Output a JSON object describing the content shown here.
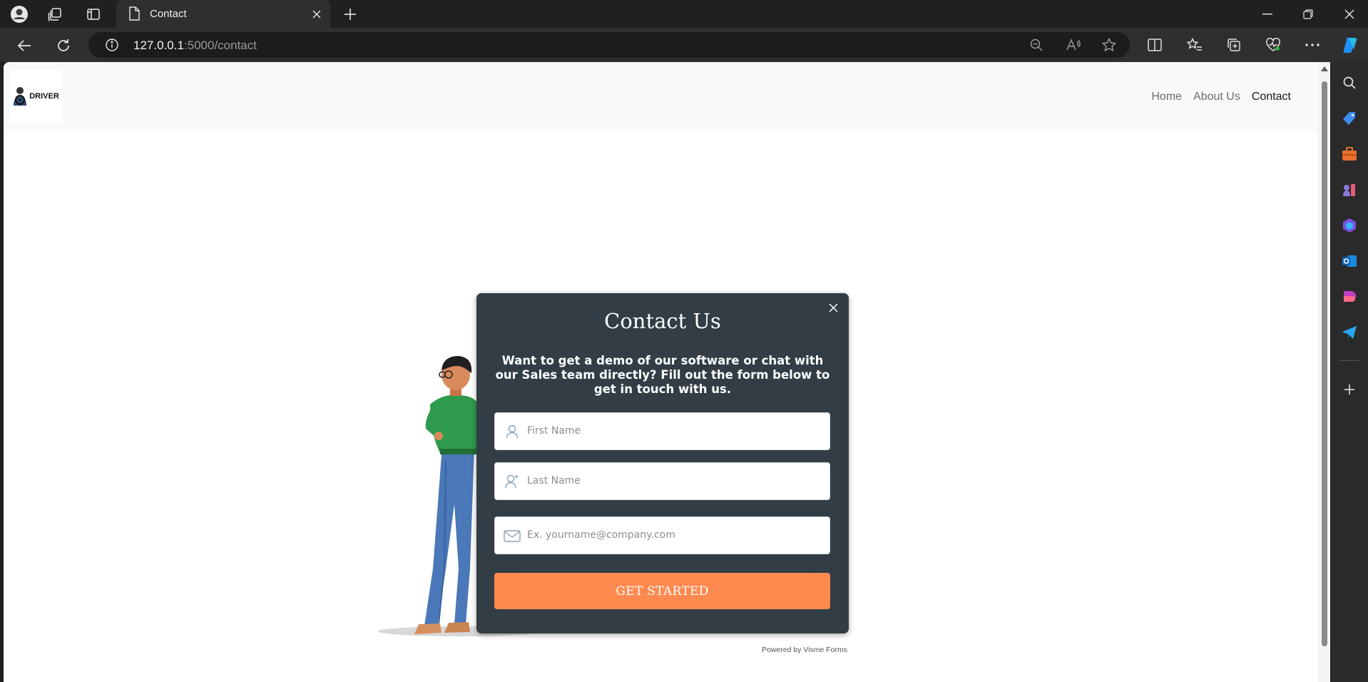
{
  "browser": {
    "tab_title": "Contact",
    "url_host": "127.0.0.1",
    "url_path": ":5000/contact"
  },
  "site": {
    "logo_text": "DRIVER",
    "nav": [
      {
        "label": "Home"
      },
      {
        "label": "About Us"
      },
      {
        "label": "Contact",
        "active": true
      }
    ]
  },
  "form": {
    "title": "Contact Us",
    "description": "Want to get a demo of our software or chat with our Sales team directly? Fill out the form below to get in touch with us.",
    "first_name_placeholder": "First Name",
    "last_name_placeholder": "Last Name",
    "email_placeholder": "Ex. yourname@company.com",
    "submit_label": "GET STARTED",
    "powered_by": "Powered by Visme Forms"
  },
  "colors": {
    "form_background": "#323d45",
    "submit_background": "#ff8a50"
  }
}
